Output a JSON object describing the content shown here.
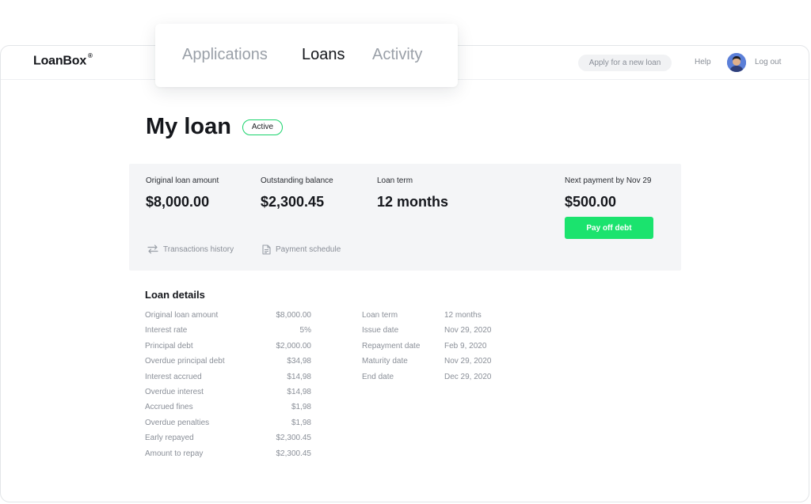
{
  "header": {
    "logo": "LoanBox",
    "logo_mark": "®",
    "apply_label": "Apply for a new loan",
    "help_label": "Help",
    "logout_label": "Log out"
  },
  "tabs": [
    {
      "label": "Applications",
      "active": false
    },
    {
      "label": "Loans",
      "active": true
    },
    {
      "label": "Activity",
      "active": false
    }
  ],
  "page": {
    "title": "My loan",
    "status": "Active"
  },
  "summary": {
    "original": {
      "label": "Original loan amount",
      "value": "$8,000.00"
    },
    "outstanding": {
      "label": "Outstanding balance",
      "value": "$2,300.45"
    },
    "term": {
      "label": "Loan term",
      "value": "12 months"
    },
    "next_payment": {
      "label": "Next payment by Nov 29",
      "value": "$500.00"
    },
    "pay_button": "Pay off debt",
    "transactions_link": "Transactions history",
    "schedule_link": "Payment schedule"
  },
  "details": {
    "title": "Loan details",
    "left": [
      {
        "label": "Original loan amount",
        "value": "$8,000.00"
      },
      {
        "label": "Interest rate",
        "value": "5%"
      },
      {
        "label": "Principal debt",
        "value": "$2,000.00"
      },
      {
        "label": "Overdue principal debt",
        "value": "$34,98"
      },
      {
        "label": "Interest accrued",
        "value": "$14,98"
      },
      {
        "label": "Overdue interest",
        "value": "$14,98"
      },
      {
        "label": "Accrued fines",
        "value": "$1,98"
      },
      {
        "label": "Overdue penalties",
        "value": "$1,98"
      },
      {
        "label": "Early repayed",
        "value": "$2,300.45"
      },
      {
        "label": "Amount to repay",
        "value": "$2,300.45"
      }
    ],
    "right": [
      {
        "label": "Loan term",
        "value": "12 months"
      },
      {
        "label": "Issue date",
        "value": "Nov 29, 2020"
      },
      {
        "label": "Repayment date",
        "value": "Feb 9, 2020"
      },
      {
        "label": "Maturity date",
        "value": "Nov 29, 2020"
      },
      {
        "label": "End date",
        "value": "Dec 29, 2020"
      }
    ]
  },
  "colors": {
    "accent_green": "#1be36e",
    "badge_border": "#19d36b",
    "muted_text": "#8a8f98",
    "panel_bg": "#f4f5f7"
  }
}
